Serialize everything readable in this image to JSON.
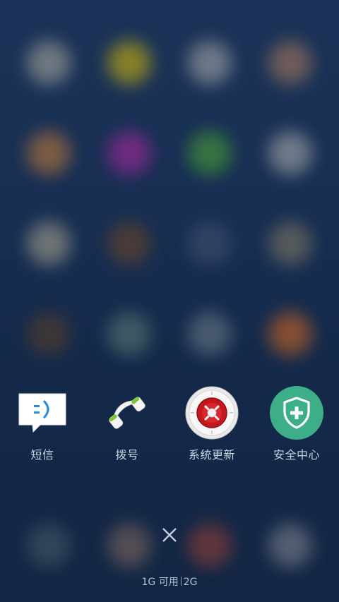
{
  "recent_apps": [
    {
      "id": "messages",
      "label": "短信",
      "icon": "message-icon"
    },
    {
      "id": "dialer",
      "label": "拨号",
      "icon": "phone-icon"
    },
    {
      "id": "system-update",
      "label": "系统更新",
      "icon": "safe-dial-icon"
    },
    {
      "id": "security-center",
      "label": "安全中心",
      "icon": "shield-plus-icon"
    }
  ],
  "close_icon": "close-icon",
  "memory": {
    "available": "1G 可用",
    "total": "2G"
  },
  "colors": {
    "background": "#172e52",
    "label_text": "#c9d2df",
    "security_green": "#3dae87",
    "dialer_green": "#78c832",
    "update_red": "#c4171d"
  }
}
